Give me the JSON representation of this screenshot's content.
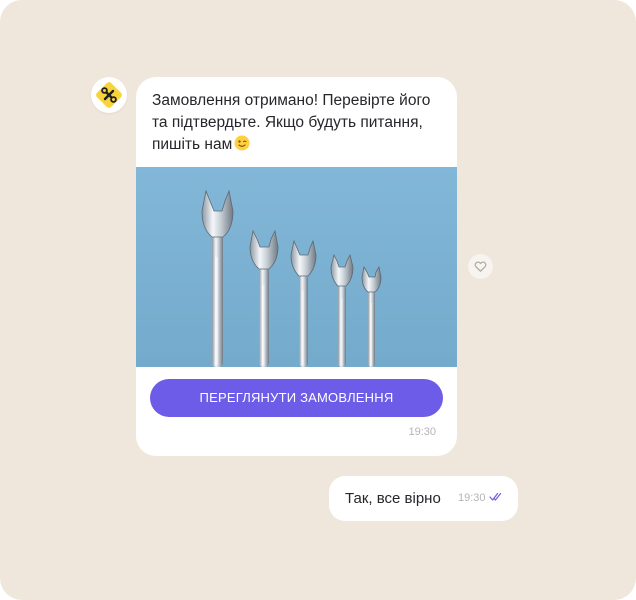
{
  "chat": {
    "incoming": {
      "text": "Замовлення отримано! Перевірте його та підтвердьте. Якщо будуть питання, пишіть нам",
      "emoji": "winking-face-emoji",
      "image": "wrenches-photo",
      "button_label": "ПЕРЕГЛЯНУТИ ЗАМОВЛЕННЯ",
      "time": "19:30"
    },
    "outgoing": {
      "text": "Так, все вірно",
      "time": "19:30",
      "status_icon": "double-check-icon"
    }
  },
  "icons": {
    "avatar": "tools-logo-icon",
    "reaction": "heart-icon"
  },
  "colors": {
    "background": "#efe6dc",
    "bubble": "#ffffff",
    "accent": "#6c5ce7",
    "avatar_badge": "#f8d33a",
    "photo_background": "#82b7d8",
    "text": "#26262b",
    "muted": "#b4b4ba"
  }
}
